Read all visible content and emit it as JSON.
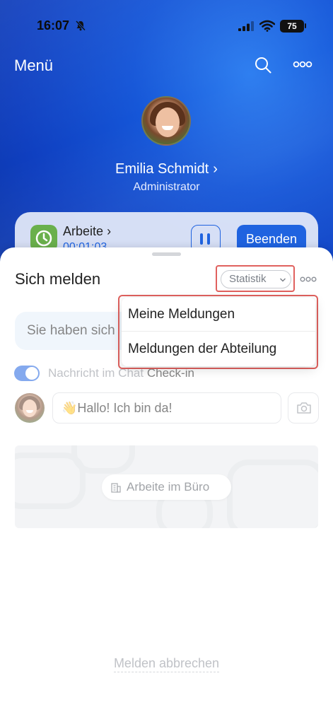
{
  "status_bar": {
    "time": "16:07",
    "battery": "75",
    "icons": [
      "bell-off-icon",
      "signal-icon",
      "wifi-icon",
      "battery-icon"
    ]
  },
  "nav": {
    "title": "Menü",
    "icons": [
      "search-icon",
      "more-icon"
    ]
  },
  "profile": {
    "name": "Emilia Schmidt",
    "chevron": "›",
    "role": "Administrator"
  },
  "work_card": {
    "label": "Arbeite",
    "chevron": "›",
    "timer": "00:01:03",
    "end_label": "Beenden",
    "icons": [
      "clock-icon",
      "pause-icon"
    ]
  },
  "sheet": {
    "title": "Sich melden",
    "statistik_label": "Statistik",
    "info_text": "Sie haben sich",
    "toggle_text": "Nachricht im Chat",
    "toggle_strong": "Check-in",
    "toggle_on": true,
    "message_value": "👋Hallo! Ich bin da!",
    "location_label": "Arbeite im Büro",
    "cancel_label": "Melden abbrechen"
  },
  "dropdown": {
    "items": [
      "Meine Meldungen",
      "Meldungen der Abteilung"
    ]
  },
  "colors": {
    "accent": "#1f63e0",
    "highlight": "#e0615e",
    "header_blue": "#1556d8"
  }
}
